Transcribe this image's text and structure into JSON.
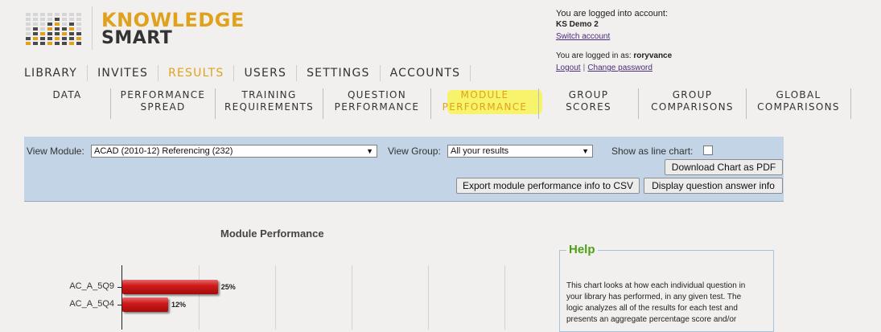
{
  "logo": {
    "line1": "KNOWLEDGE",
    "line2": "SMART"
  },
  "account": {
    "logged_into_label": "You are logged into account:",
    "account_name": "KS Demo 2",
    "switch_link": "Switch account",
    "logged_in_as_label": "You are logged in as:",
    "username": "roryvance",
    "logout_link": "Logout",
    "separator": "|",
    "change_password_link": "Change password"
  },
  "main_nav": [
    "LIBRARY",
    "INVITES",
    "RESULTS",
    "USERS",
    "SETTINGS",
    "ACCOUNTS"
  ],
  "main_nav_active": "RESULTS",
  "sub_nav": [
    {
      "line1": "DATA",
      "line2": ""
    },
    {
      "line1": "PERFORMANCE",
      "line2": "SPREAD"
    },
    {
      "line1": "TRAINING",
      "line2": "REQUIREMENTS"
    },
    {
      "line1": "QUESTION",
      "line2": "PERFORMANCE"
    },
    {
      "line1": "MODULE",
      "line2": "PERFORMANCE"
    },
    {
      "line1": "GROUP",
      "line2": "SCORES"
    },
    {
      "line1": "GROUP",
      "line2": "COMPARISONS"
    },
    {
      "line1": "GLOBAL",
      "line2": "COMPARISONS"
    }
  ],
  "filters": {
    "view_module_label": "View Module:",
    "view_module_value": "ACAD (2010-12) Referencing (232)",
    "view_group_label": "View Group:",
    "view_group_value": "All your results",
    "line_chart_label": "Show as line chart:",
    "line_chart_checked": false,
    "download_pdf_button": "Download Chart as PDF",
    "export_csv_button": "Export module performance info to CSV",
    "display_answers_button": "Display question answer info"
  },
  "chart_data": {
    "type": "bar",
    "orientation": "horizontal",
    "title": "Module Performance",
    "categories": [
      "AC_A_5Q9",
      "AC_A_5Q4"
    ],
    "values": [
      25,
      12
    ],
    "value_labels": [
      "25%",
      "12%"
    ],
    "xlim": [
      0,
      100
    ],
    "grid": true,
    "bar_color": "#d11a1a"
  },
  "help": {
    "title": "Help",
    "lines": [
      "This chart looks at how each individual question in",
      "your library has performed, in any given test. The",
      "logic analyzes all of the results for each test and",
      "presents an aggregate percentage score and/or"
    ]
  },
  "colors": {
    "accent": "#e0a21c",
    "filter_panel": "#c2d4e6",
    "help_title": "#4fa016"
  }
}
